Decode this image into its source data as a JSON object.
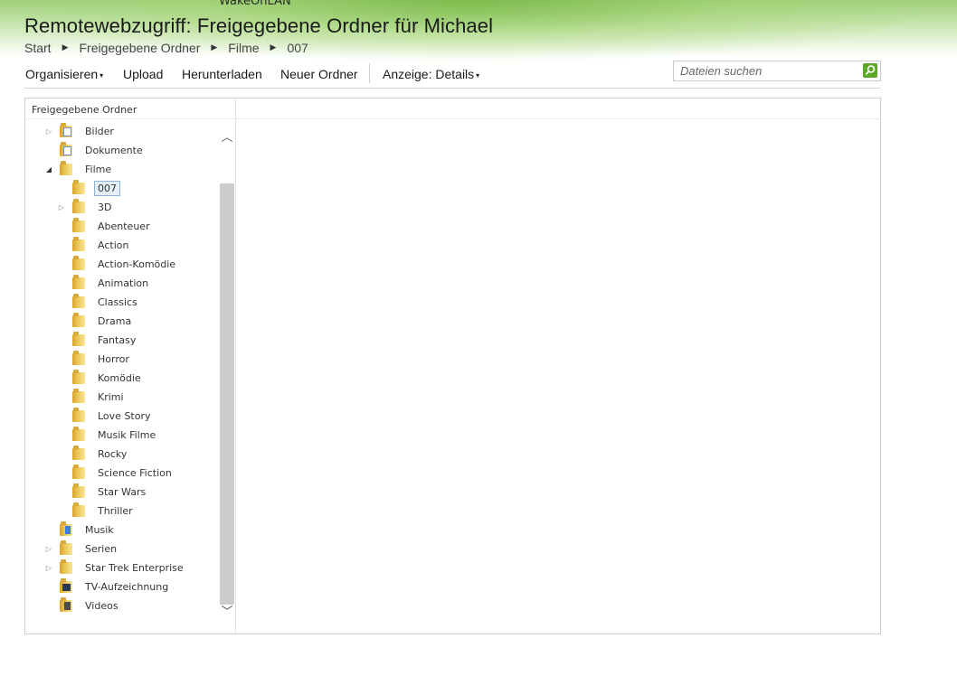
{
  "app_label": "WakeOnLAN",
  "page_title": "Remotewebzugriff: Freigegebene Ordner für Michael",
  "breadcrumb": {
    "items": [
      "Start",
      "Freigegebene Ordner",
      "Filme",
      "007"
    ],
    "separator": "▶"
  },
  "toolbar": {
    "organize": "Organisieren",
    "upload": "Upload",
    "download": "Herunterladen",
    "new_folder": "Neuer Ordner",
    "view": "Anzeige: Details",
    "caret": "▾"
  },
  "search": {
    "placeholder": "Dateien suchen",
    "icon": "search-icon"
  },
  "tree": {
    "header": "Freigegebene Ordner",
    "items": [
      {
        "label": "Bilder",
        "icon": "pictures-folder-icon",
        "expander": "collapsed",
        "level": 0
      },
      {
        "label": "Dokumente",
        "icon": "documents-folder-icon",
        "expander": "none",
        "level": 0
      },
      {
        "label": "Filme",
        "icon": "folder-icon",
        "expander": "expanded",
        "level": 0
      },
      {
        "label": "007",
        "icon": "folder-icon",
        "expander": "none",
        "level": 1,
        "selected": true
      },
      {
        "label": "3D",
        "icon": "folder-icon",
        "expander": "collapsed",
        "level": 1
      },
      {
        "label": "Abenteuer",
        "icon": "folder-icon",
        "expander": "none",
        "level": 1
      },
      {
        "label": "Action",
        "icon": "folder-icon",
        "expander": "none",
        "level": 1
      },
      {
        "label": "Action-Komödie",
        "icon": "folder-icon",
        "expander": "none",
        "level": 1
      },
      {
        "label": "Animation",
        "icon": "folder-icon",
        "expander": "none",
        "level": 1
      },
      {
        "label": "Classics",
        "icon": "folder-icon",
        "expander": "none",
        "level": 1
      },
      {
        "label": "Drama",
        "icon": "folder-icon",
        "expander": "none",
        "level": 1
      },
      {
        "label": "Fantasy",
        "icon": "folder-icon",
        "expander": "none",
        "level": 1
      },
      {
        "label": "Horror",
        "icon": "folder-icon",
        "expander": "none",
        "level": 1
      },
      {
        "label": "Komödie",
        "icon": "folder-icon",
        "expander": "none",
        "level": 1
      },
      {
        "label": "Krimi",
        "icon": "folder-icon",
        "expander": "none",
        "level": 1
      },
      {
        "label": "Love Story",
        "icon": "folder-icon",
        "expander": "none",
        "level": 1
      },
      {
        "label": "Musik Filme",
        "icon": "folder-icon",
        "expander": "none",
        "level": 1
      },
      {
        "label": "Rocky",
        "icon": "folder-icon",
        "expander": "none",
        "level": 1
      },
      {
        "label": "Science Fiction",
        "icon": "folder-icon",
        "expander": "none",
        "level": 1
      },
      {
        "label": "Star Wars",
        "icon": "folder-icon",
        "expander": "none",
        "level": 1
      },
      {
        "label": "Thriller",
        "icon": "folder-icon",
        "expander": "none",
        "level": 1
      },
      {
        "label": "Musik",
        "icon": "music-folder-icon",
        "expander": "none",
        "level": 0
      },
      {
        "label": "Serien",
        "icon": "folder-icon",
        "expander": "collapsed",
        "level": 0
      },
      {
        "label": "Star Trek Enterprise",
        "icon": "folder-icon",
        "expander": "collapsed",
        "level": 0
      },
      {
        "label": "TV-Aufzeichnung",
        "icon": "tv-folder-icon",
        "expander": "none",
        "level": 0
      },
      {
        "label": "Videos",
        "icon": "video-folder-icon",
        "expander": "none",
        "level": 0
      }
    ]
  },
  "colors": {
    "accent_green": "#5da82a",
    "selection_bg": "#e5effa",
    "selection_border": "#8fb4dc",
    "scroll_track": "#cdcdcd"
  }
}
